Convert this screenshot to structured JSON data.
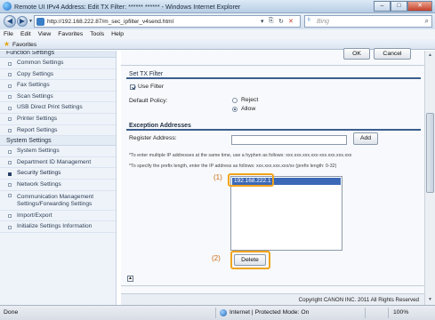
{
  "window": {
    "title": "Remote UI IPv4 Address: Edit TX Filter: ****** ****** - Windows Internet Explorer",
    "buttons": [
      "–",
      "□",
      "✕"
    ]
  },
  "addressbar": {
    "url": "http://192.168.222.87/m_sec_ipfilter_v4send.html",
    "search_placeholder": "Bing"
  },
  "menubar": [
    "File",
    "Edit",
    "View",
    "Favorites",
    "Tools",
    "Help"
  ],
  "favorites": {
    "label": "Favorites"
  },
  "sidebar": {
    "sections": [
      {
        "title": "Function Settings",
        "items": [
          "Common Settings",
          "Copy Settings",
          "Fax Settings",
          "Scan Settings",
          "USB Direct Print Settings",
          "Printer Settings",
          "Report Settings"
        ]
      },
      {
        "title": "System Settings",
        "items": [
          "System Settings",
          "Department ID Management",
          "Security Settings",
          "Network Settings",
          "Communication Management Settings/Forwarding Settings",
          "Import/Export",
          "Initialize Settings Information"
        ]
      }
    ],
    "active_item": "Security Settings"
  },
  "main": {
    "top_buttons": {
      "ok": "OK",
      "cancel": "Cancel"
    },
    "tx_filter": {
      "title": "Set TX Filter",
      "use_filter_label": "Use Filter",
      "use_filter_checked": true,
      "default_policy_label": "Default Policy:",
      "policy_options": [
        "Reject",
        "Allow"
      ],
      "policy_selected": "Allow"
    },
    "exceptions": {
      "title": "Exception Addresses",
      "register_label": "Register Address:",
      "register_value": "",
      "add_button": "Add",
      "note1": "*To enter multiple IP addresses at the same time, use a hyphen as follows: xxx.xxx.xxx.xxx-xxx.xxx.xxx.xxx",
      "note2": "*To specify the prefix length, enter the IP address as follows: xxx.xxx.xxx.xxx/xx (prefix length: 0-32)",
      "addresses": [
        "192.168.222.1"
      ],
      "delete_button": "Delete",
      "callout1": "(1)",
      "callout2": "(2)"
    },
    "footer": {
      "copyright": "Copyright CANON INC. 2011 All Rights Reserved"
    }
  },
  "statusbar": {
    "status": "Done",
    "zone": "Internet | Protected Mode: On",
    "zoom": "100%"
  },
  "colors": {
    "accent": "#3b5f8f",
    "selection": "#3c69b7",
    "callout": "#f1a31c"
  }
}
